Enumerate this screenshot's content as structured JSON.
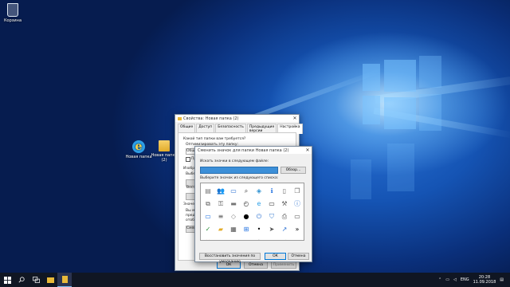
{
  "desktop": {
    "icons": [
      {
        "label": "Корзина"
      },
      {
        "label": "Новая папка"
      },
      {
        "label": "Новая папка (2)"
      }
    ]
  },
  "properties_window": {
    "title": "Свойства: Новая папка (2)",
    "tabs": [
      "Общие",
      "Доступ",
      "Безопасность",
      "Предыдущие версии",
      "Настройка"
    ],
    "active_tab": "Настройка",
    "rows": [
      "Какой тип папки вам требуется?",
      "Оптимизировать эту папку:",
      "Общ",
      "При",
      "Изобр",
      "Выбе",
      "Восс",
      "Значе",
      "Вы м",
      "предс",
      "отобр",
      "Смен"
    ],
    "buttons": {
      "ok": "ОК",
      "cancel": "Отмена",
      "apply": "Применить"
    }
  },
  "change_icon_dialog": {
    "title": "Сменить значок для папки Новая папка (2)",
    "search_label": "Искать значки в следующем файле:",
    "browse_button": "Обзор...",
    "select_label": "Выберите значок из следующего списка:",
    "icons": [
      "clipboard-icon",
      "people-icon",
      "monitor-icon",
      "magnifier-icon",
      "network-icon",
      "info-icon",
      "document-icon",
      "documents-icon",
      "copy-icon",
      "key-icon",
      "drive-icon",
      "clock-icon",
      "ie-icon",
      "monitor-dark-icon",
      "tools-icon",
      "info-circle-icon",
      "monitor-blue-icon",
      "list-icon",
      "tag-icon",
      "dot-icon",
      "power-icon",
      "shield-icon",
      "printer-icon",
      "display-icon",
      "ok-mark-icon",
      "folder-icon",
      "calendar-icon",
      "windows-icon",
      "bullet-icon",
      "cursor-icon",
      "arrow-icon",
      "chevron-double-icon",
      "red-x-icon",
      "folder-x-icon",
      "folder-open-icon",
      "folder-plus-icon",
      "star-icon",
      "folder-gear-icon",
      "check-icon",
      "blank-icon"
    ],
    "restore_button": "Восстановить значения по умолчанию",
    "ok_button": "ОК",
    "cancel_button": "Отмена"
  },
  "taskbar": {
    "language": "ENG",
    "time": "20:28",
    "date": "11.09.2018"
  }
}
